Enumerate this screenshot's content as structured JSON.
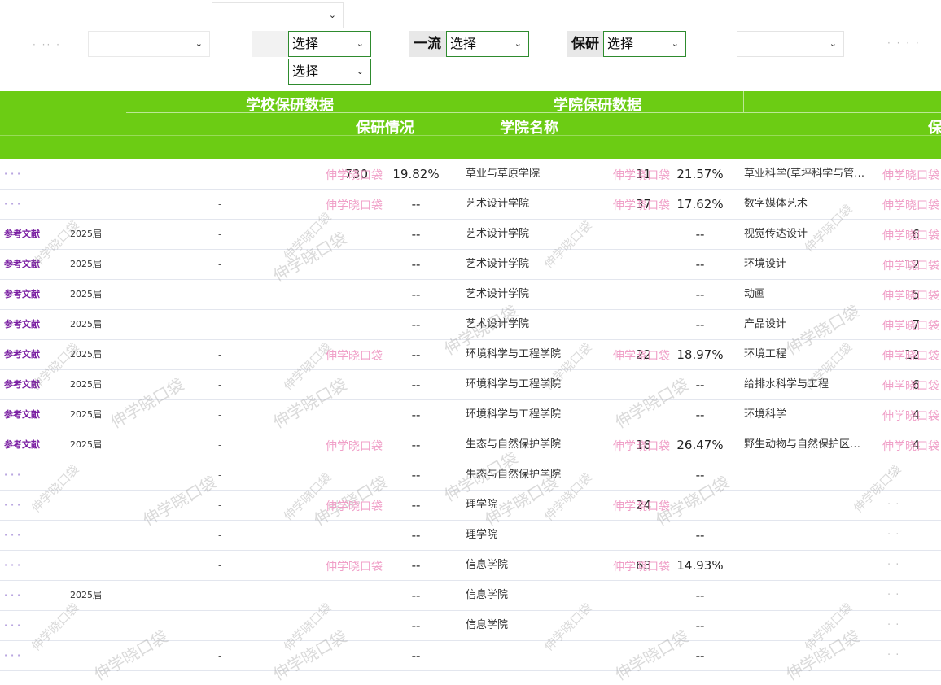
{
  "filters": {
    "select_placeholder": "选择",
    "chevron": "⌄",
    "first_class_label": "一流",
    "baoyan_label": "保研"
  },
  "header": {
    "school_data": "学校保研数据",
    "baoyan_status": "保研情况",
    "college_data": "学院保研数据",
    "college_name": "学院名称",
    "right_edge": "保"
  },
  "rows": [
    {
      "ref": "",
      "year": "",
      "dash": "",
      "snum": "730",
      "srate": "19.82%",
      "college": "草业与草原学院",
      "cnum": "11",
      "crate": "21.57%",
      "major": "草业科学(草坪科学与管…",
      "mnum": "",
      "blur": true
    },
    {
      "ref": "",
      "year": "",
      "dash": "-",
      "snum": "",
      "srate": "--",
      "college": "艺术设计学院",
      "cnum": "37",
      "crate": "17.62%",
      "major": "数字媒体艺术",
      "mnum": "",
      "blur": true
    },
    {
      "ref": "参考文献",
      "year": "2025届",
      "dash": "-",
      "snum": "",
      "srate": "--",
      "college": "艺术设计学院",
      "cnum": "",
      "crate": "--",
      "major": "视觉传达设计",
      "mnum": "6"
    },
    {
      "ref": "参考文献",
      "year": "2025届",
      "dash": "-",
      "snum": "",
      "srate": "--",
      "college": "艺术设计学院",
      "cnum": "",
      "crate": "--",
      "major": "环境设计",
      "mnum": "12"
    },
    {
      "ref": "参考文献",
      "year": "2025届",
      "dash": "-",
      "snum": "",
      "srate": "--",
      "college": "艺术设计学院",
      "cnum": "",
      "crate": "--",
      "major": "动画",
      "mnum": "5"
    },
    {
      "ref": "参考文献",
      "year": "2025届",
      "dash": "-",
      "snum": "",
      "srate": "--",
      "college": "艺术设计学院",
      "cnum": "",
      "crate": "--",
      "major": "产品设计",
      "mnum": "7"
    },
    {
      "ref": "参考文献",
      "year": "2025届",
      "dash": "-",
      "snum": "",
      "srate": "--",
      "college": "环境科学与工程学院",
      "cnum": "22",
      "crate": "18.97%",
      "major": "环境工程",
      "mnum": "12"
    },
    {
      "ref": "参考文献",
      "year": "2025届",
      "dash": "-",
      "snum": "",
      "srate": "--",
      "college": "环境科学与工程学院",
      "cnum": "",
      "crate": "--",
      "major": "给排水科学与工程",
      "mnum": "6"
    },
    {
      "ref": "参考文献",
      "year": "2025届",
      "dash": "-",
      "snum": "",
      "srate": "--",
      "college": "环境科学与工程学院",
      "cnum": "",
      "crate": "--",
      "major": "环境科学",
      "mnum": "4"
    },
    {
      "ref": "参考文献",
      "year": "2025届",
      "dash": "-",
      "snum": "",
      "srate": "--",
      "college": "生态与自然保护学院",
      "cnum": "18",
      "crate": "26.47%",
      "major": "野生动物与自然保护区…",
      "mnum": "4"
    },
    {
      "ref": "",
      "year": "",
      "dash": "-",
      "snum": "",
      "srate": "--",
      "college": "生态与自然保护学院",
      "cnum": "",
      "crate": "--",
      "major": "",
      "mnum": "",
      "blur": true
    },
    {
      "ref": "",
      "year": "",
      "dash": "-",
      "snum": "",
      "srate": "--",
      "college": "理学院",
      "cnum": "24",
      "crate": "",
      "major": "",
      "mnum": "",
      "blur": true
    },
    {
      "ref": "",
      "year": "",
      "dash": "-",
      "snum": "",
      "srate": "--",
      "college": "理学院",
      "cnum": "",
      "crate": "--",
      "major": "",
      "mnum": "",
      "blur": true
    },
    {
      "ref": "",
      "year": "",
      "dash": "-",
      "snum": "",
      "srate": "--",
      "college": "信息学院",
      "cnum": "63",
      "crate": "14.93%",
      "major": "",
      "mnum": "",
      "blur": true
    },
    {
      "ref": "",
      "year": "2025届",
      "dash": "-",
      "snum": "",
      "srate": "--",
      "college": "信息学院",
      "cnum": "",
      "crate": "--",
      "major": "",
      "mnum": "",
      "blur": true
    },
    {
      "ref": "",
      "year": "",
      "dash": "-",
      "snum": "",
      "srate": "--",
      "college": "信息学院",
      "cnum": "",
      "crate": "--",
      "major": "",
      "mnum": "",
      "blur": true
    },
    {
      "ref": "",
      "year": "",
      "dash": "-",
      "snum": "",
      "srate": "--",
      "college": "",
      "cnum": "",
      "crate": "--",
      "major": "",
      "mnum": "",
      "blur": true
    }
  ],
  "watermark_text": "伸学晓口袋",
  "colors": {
    "header_green": "#6ccc14",
    "select_border": "#2e8b2e",
    "ref_link": "#7a1fa2",
    "watermark_pink": "#f0a0c8"
  }
}
